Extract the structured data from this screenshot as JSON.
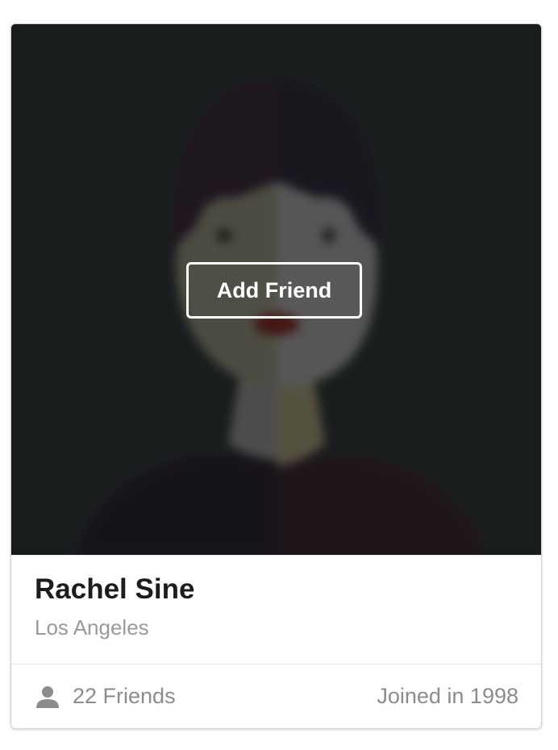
{
  "card": {
    "overlay_button": "Add Friend",
    "name": "Rachel Sine",
    "location": "Los Angeles",
    "friends": "22 Friends",
    "joined": "Joined in 1998",
    "friends_icon": "user-icon"
  },
  "colors": {
    "overlay_bg": "#2a2d2e",
    "name_text": "#1b1c1d",
    "meta_text": "#9a9a9a"
  }
}
